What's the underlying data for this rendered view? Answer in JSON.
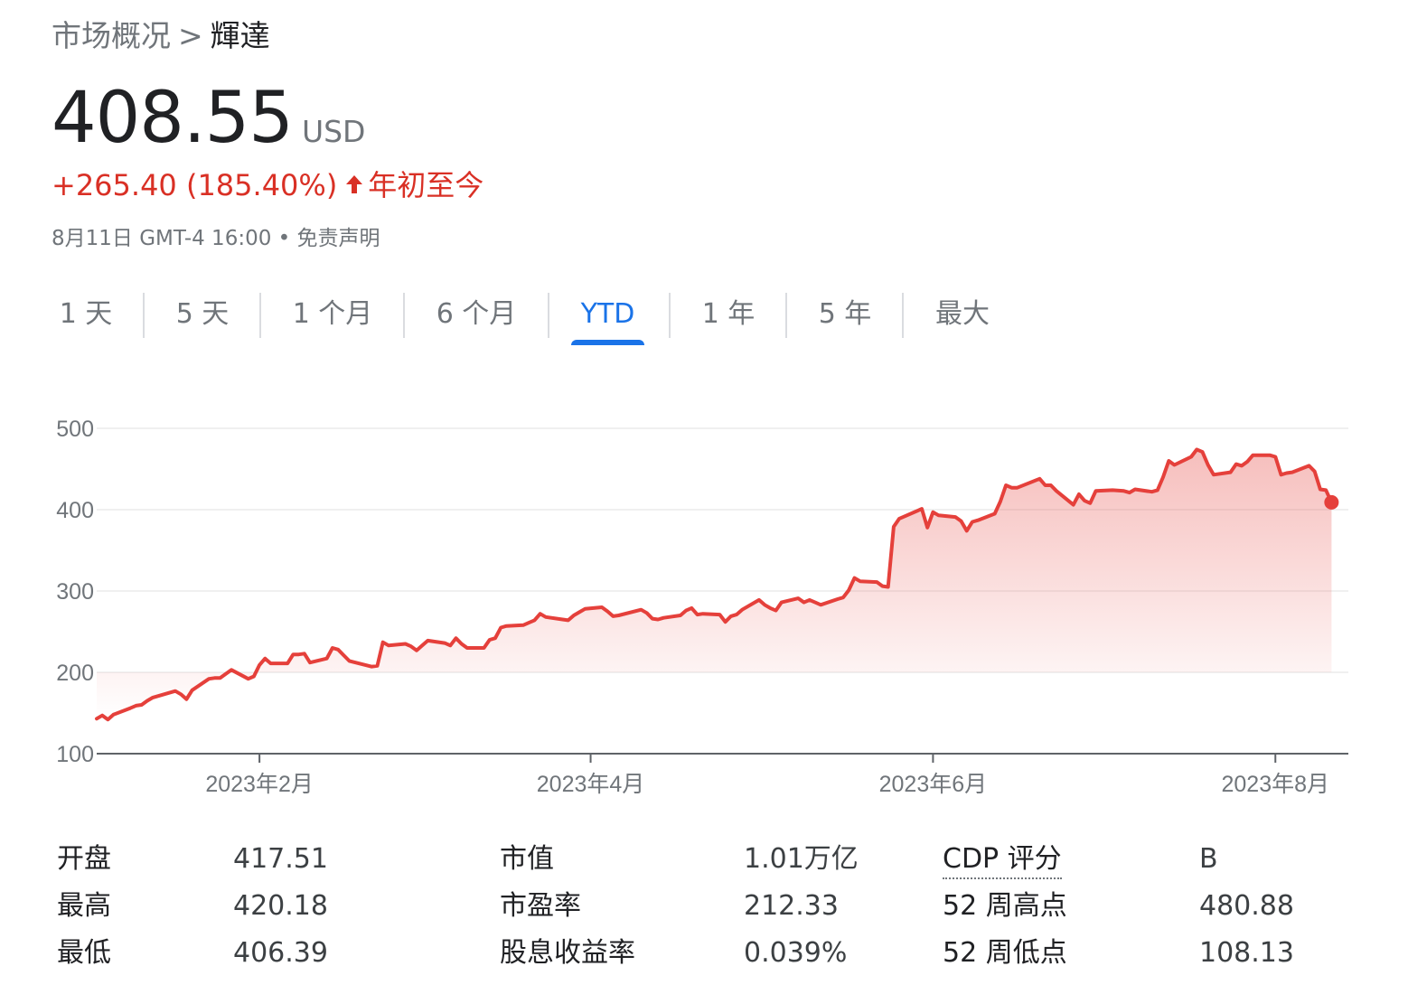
{
  "breadcrumb": {
    "parent": "市场概况",
    "separator": ">",
    "current": "輝達"
  },
  "quote": {
    "price": "408.55",
    "currency": "USD",
    "change": "+265.40 (185.40%)",
    "change_arrow": "up-arrow-icon",
    "period_label": "年初至今",
    "timestamp": "8月11日 GMT-4 16:00 • 免责声明"
  },
  "tabs": [
    {
      "label": "1 天"
    },
    {
      "label": "5 天"
    },
    {
      "label": "1 个月"
    },
    {
      "label": "6 个月"
    },
    {
      "label": "YTD",
      "active": true
    },
    {
      "label": "1 年"
    },
    {
      "label": "5 年"
    },
    {
      "label": "最大"
    }
  ],
  "colors": {
    "line": "#e5403b",
    "fill": "#e5403b",
    "active_tab": "#1a73e8",
    "negative_up": "#d93025"
  },
  "chart_data": {
    "type": "area",
    "ylim": [
      100,
      500
    ],
    "yticks": [
      "500",
      "400",
      "300",
      "200",
      "100"
    ],
    "ytick_values": [
      500,
      400,
      300,
      200,
      100
    ],
    "xtick_labels": [
      "2023年2月",
      "2023年4月",
      "2023年6月",
      "2023年8月"
    ],
    "xtick_dates": [
      "2023-02-01",
      "2023-04-01",
      "2023-06-01",
      "2023-08-01"
    ],
    "x_range": [
      "2023-01-03",
      "2023-08-14"
    ],
    "grid": true,
    "series": [
      {
        "points": [
          [
            "2023-01-03",
            143
          ],
          [
            "2023-01-04",
            147
          ],
          [
            "2023-01-05",
            142
          ],
          [
            "2023-01-06",
            148
          ],
          [
            "2023-01-09",
            156
          ],
          [
            "2023-01-10",
            159
          ],
          [
            "2023-01-11",
            160
          ],
          [
            "2023-01-12",
            165
          ],
          [
            "2023-01-13",
            169
          ],
          [
            "2023-01-17",
            177
          ],
          [
            "2023-01-18",
            173
          ],
          [
            "2023-01-19",
            167
          ],
          [
            "2023-01-20",
            178
          ],
          [
            "2023-01-23",
            192
          ],
          [
            "2023-01-24",
            193
          ],
          [
            "2023-01-25",
            193
          ],
          [
            "2023-01-26",
            198
          ],
          [
            "2023-01-27",
            203
          ],
          [
            "2023-01-30",
            192
          ],
          [
            "2023-01-31",
            195
          ],
          [
            "2023-02-01",
            209
          ],
          [
            "2023-02-02",
            217
          ],
          [
            "2023-02-03",
            211
          ],
          [
            "2023-02-06",
            211
          ],
          [
            "2023-02-07",
            222
          ],
          [
            "2023-02-08",
            222
          ],
          [
            "2023-02-09",
            223
          ],
          [
            "2023-02-10",
            212
          ],
          [
            "2023-02-13",
            217
          ],
          [
            "2023-02-14",
            230
          ],
          [
            "2023-02-15",
            228
          ],
          [
            "2023-02-16",
            221
          ],
          [
            "2023-02-17",
            214
          ],
          [
            "2023-02-21",
            207
          ],
          [
            "2023-02-22",
            208
          ],
          [
            "2023-02-23",
            237
          ],
          [
            "2023-02-24",
            233
          ],
          [
            "2023-02-27",
            235
          ],
          [
            "2023-02-28",
            232
          ],
          [
            "2023-03-01",
            227
          ],
          [
            "2023-03-02",
            233
          ],
          [
            "2023-03-03",
            239
          ],
          [
            "2023-03-06",
            236
          ],
          [
            "2023-03-07",
            233
          ],
          [
            "2023-03-08",
            242
          ],
          [
            "2023-03-09",
            235
          ],
          [
            "2023-03-10",
            230
          ],
          [
            "2023-03-13",
            230
          ],
          [
            "2023-03-14",
            240
          ],
          [
            "2023-03-15",
            242
          ],
          [
            "2023-03-16",
            255
          ],
          [
            "2023-03-17",
            257
          ],
          [
            "2023-03-20",
            258
          ],
          [
            "2023-03-21",
            261
          ],
          [
            "2023-03-22",
            264
          ],
          [
            "2023-03-23",
            272
          ],
          [
            "2023-03-24",
            268
          ],
          [
            "2023-03-27",
            265
          ],
          [
            "2023-03-28",
            264
          ],
          [
            "2023-03-29",
            270
          ],
          [
            "2023-03-30",
            274
          ],
          [
            "2023-03-31",
            278
          ],
          [
            "2023-04-03",
            280
          ],
          [
            "2023-04-04",
            275
          ],
          [
            "2023-04-05",
            269
          ],
          [
            "2023-04-06",
            270
          ],
          [
            "2023-04-10",
            277
          ],
          [
            "2023-04-11",
            273
          ],
          [
            "2023-04-12",
            266
          ],
          [
            "2023-04-13",
            265
          ],
          [
            "2023-04-14",
            267
          ],
          [
            "2023-04-17",
            270
          ],
          [
            "2023-04-18",
            276
          ],
          [
            "2023-04-19",
            279
          ],
          [
            "2023-04-20",
            271
          ],
          [
            "2023-04-21",
            272
          ],
          [
            "2023-04-24",
            271
          ],
          [
            "2023-04-25",
            262
          ],
          [
            "2023-04-26",
            269
          ],
          [
            "2023-04-27",
            271
          ],
          [
            "2023-04-28",
            277
          ],
          [
            "2023-05-01",
            289
          ],
          [
            "2023-05-02",
            283
          ],
          [
            "2023-05-03",
            279
          ],
          [
            "2023-05-04",
            276
          ],
          [
            "2023-05-05",
            286
          ],
          [
            "2023-05-08",
            291
          ],
          [
            "2023-05-09",
            286
          ],
          [
            "2023-05-10",
            289
          ],
          [
            "2023-05-11",
            286
          ],
          [
            "2023-05-12",
            283
          ],
          [
            "2023-05-15",
            290
          ],
          [
            "2023-05-16",
            292
          ],
          [
            "2023-05-17",
            301
          ],
          [
            "2023-05-18",
            316
          ],
          [
            "2023-05-19",
            312
          ],
          [
            "2023-05-22",
            311
          ],
          [
            "2023-05-23",
            306
          ],
          [
            "2023-05-24",
            305
          ],
          [
            "2023-05-25",
            379
          ],
          [
            "2023-05-26",
            389
          ],
          [
            "2023-05-30",
            401
          ],
          [
            "2023-05-31",
            378
          ],
          [
            "2023-06-01",
            397
          ],
          [
            "2023-06-02",
            393
          ],
          [
            "2023-06-05",
            391
          ],
          [
            "2023-06-06",
            386
          ],
          [
            "2023-06-07",
            374
          ],
          [
            "2023-06-08",
            385
          ],
          [
            "2023-06-09",
            387
          ],
          [
            "2023-06-12",
            395
          ],
          [
            "2023-06-13",
            410
          ],
          [
            "2023-06-14",
            430
          ],
          [
            "2023-06-15",
            427
          ],
          [
            "2023-06-16",
            427
          ],
          [
            "2023-06-20",
            438
          ],
          [
            "2023-06-21",
            430
          ],
          [
            "2023-06-22",
            430
          ],
          [
            "2023-06-23",
            423
          ],
          [
            "2023-06-26",
            406
          ],
          [
            "2023-06-27",
            419
          ],
          [
            "2023-06-28",
            411
          ],
          [
            "2023-06-29",
            408
          ],
          [
            "2023-06-30",
            423
          ],
          [
            "2023-07-03",
            424
          ],
          [
            "2023-07-05",
            423
          ],
          [
            "2023-07-06",
            421
          ],
          [
            "2023-07-07",
            425
          ],
          [
            "2023-07-10",
            422
          ],
          [
            "2023-07-11",
            424
          ],
          [
            "2023-07-12",
            440
          ],
          [
            "2023-07-13",
            460
          ],
          [
            "2023-07-14",
            455
          ],
          [
            "2023-07-17",
            465
          ],
          [
            "2023-07-18",
            474
          ],
          [
            "2023-07-19",
            471
          ],
          [
            "2023-07-20",
            455
          ],
          [
            "2023-07-21",
            443
          ],
          [
            "2023-07-24",
            446
          ],
          [
            "2023-07-25",
            456
          ],
          [
            "2023-07-26",
            454
          ],
          [
            "2023-07-27",
            459
          ],
          [
            "2023-07-28",
            467
          ],
          [
            "2023-07-31",
            467
          ],
          [
            "2023-08-01",
            465
          ],
          [
            "2023-08-02",
            443
          ],
          [
            "2023-08-03",
            445
          ],
          [
            "2023-08-04",
            446
          ],
          [
            "2023-08-07",
            454
          ],
          [
            "2023-08-08",
            447
          ],
          [
            "2023-08-09",
            425
          ],
          [
            "2023-08-10",
            424
          ],
          [
            "2023-08-11",
            409
          ]
        ]
      }
    ]
  },
  "stats": [
    {
      "label": "开盘",
      "value": "417.51"
    },
    {
      "label": "最高",
      "value": "420.18"
    },
    {
      "label": "最低",
      "value": "406.39"
    },
    {
      "label": "市值",
      "value": "1.01万亿"
    },
    {
      "label": "市盈率",
      "value": "212.33"
    },
    {
      "label": "股息收益率",
      "value": "0.039%"
    },
    {
      "label": "CDP 评分",
      "value": "B"
    },
    {
      "label": "52 周高点",
      "value": "480.88"
    },
    {
      "label": "52 周低点",
      "value": "108.13"
    }
  ]
}
